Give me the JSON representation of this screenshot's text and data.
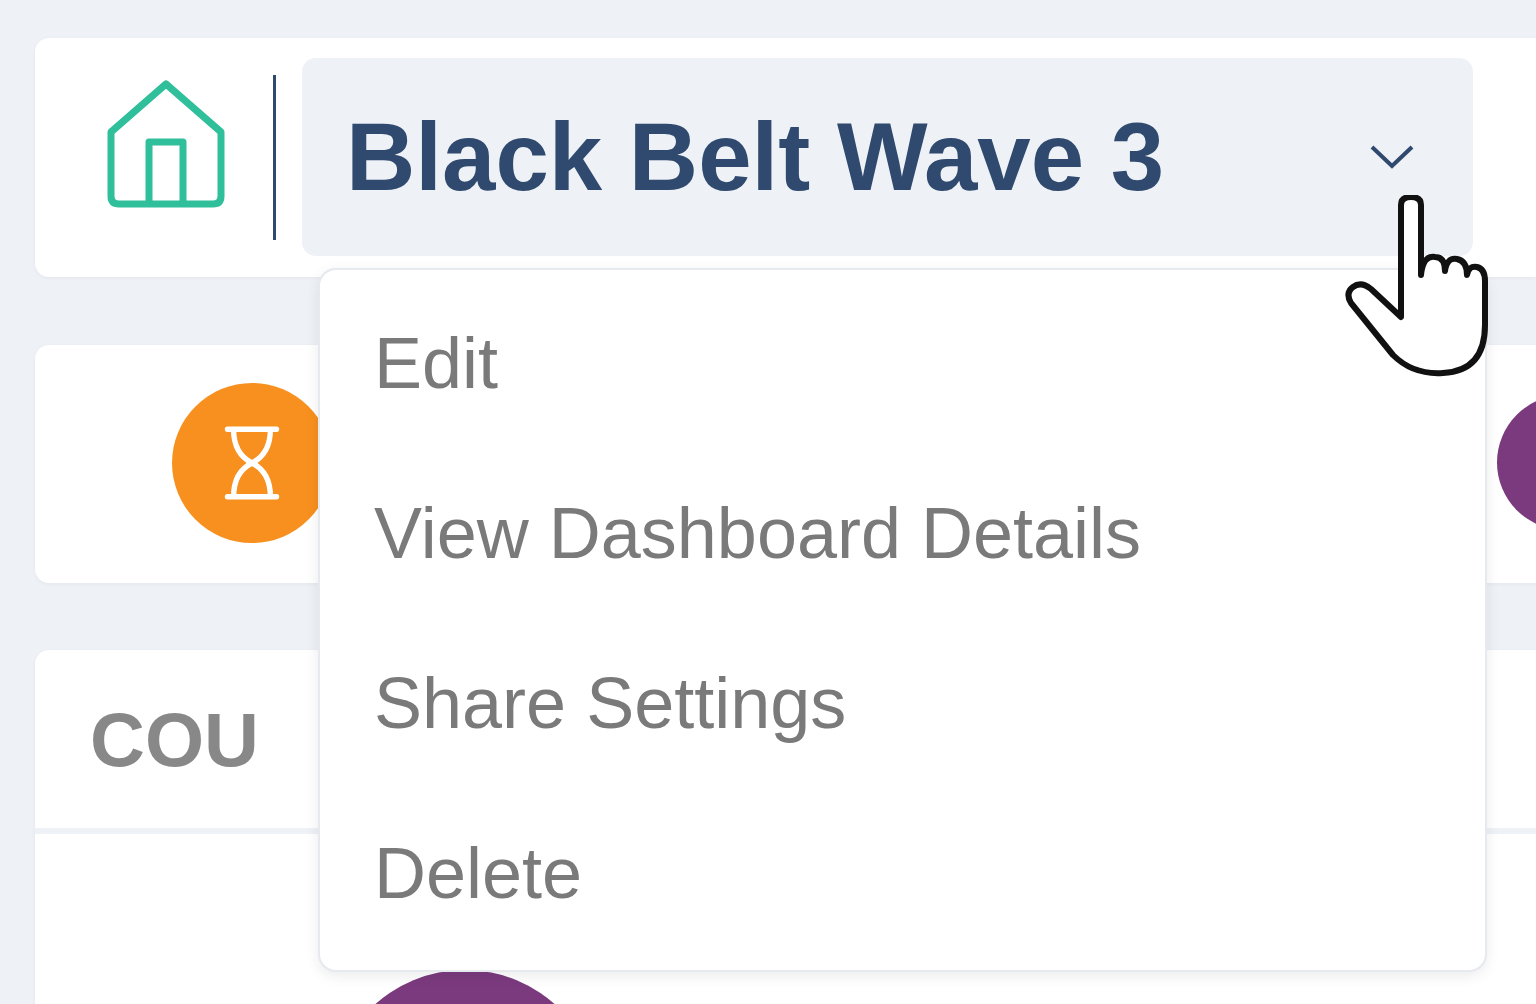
{
  "header": {
    "title": "Black Belt Wave 3",
    "menu_open": true
  },
  "menu": {
    "items": [
      {
        "label": "Edit"
      },
      {
        "label": "View Dashboard Details"
      },
      {
        "label": "Share Settings"
      },
      {
        "label": "Delete"
      }
    ]
  },
  "status_card": {
    "items": [
      {
        "kind": "hourglass",
        "color": "#f7901e"
      },
      {
        "color": "#7b3a7e"
      }
    ]
  },
  "course_card": {
    "heading": "COU"
  }
}
